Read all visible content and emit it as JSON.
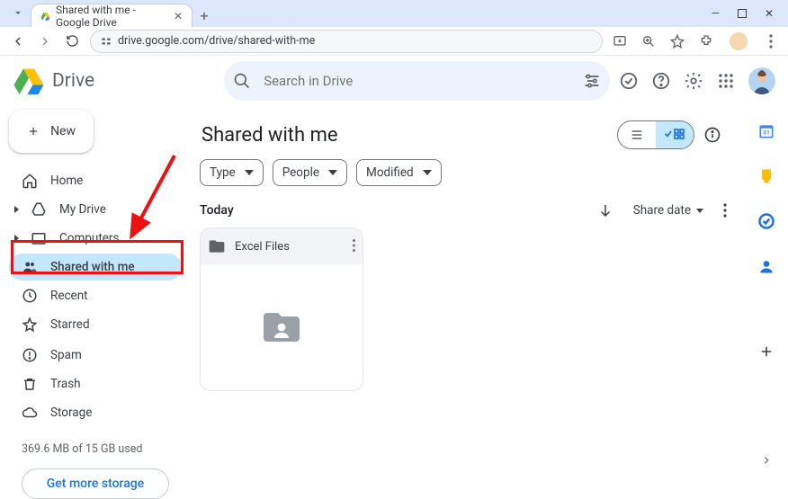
{
  "browser": {
    "tab_title": "Shared with me - Google Drive",
    "url": "drive.google.com/drive/shared-with-me"
  },
  "app": {
    "name": "Drive",
    "search_placeholder": "Search in Drive"
  },
  "sidebar": {
    "new_label": "New",
    "items": [
      {
        "label": "Home",
        "selected": false
      },
      {
        "label": "My Drive",
        "selected": false
      },
      {
        "label": "Computers",
        "selected": false
      },
      {
        "label": "Shared with me",
        "selected": true
      },
      {
        "label": "Recent",
        "selected": false
      },
      {
        "label": "Starred",
        "selected": false
      },
      {
        "label": "Spam",
        "selected": false
      },
      {
        "label": "Trash",
        "selected": false
      },
      {
        "label": "Storage",
        "selected": false
      }
    ],
    "quota_text": "369.6 MB of 15 GB used",
    "storage_btn": "Get more storage"
  },
  "content": {
    "title": "Shared with me",
    "chips": [
      "Type",
      "People",
      "Modified"
    ],
    "section_label": "Today",
    "sort_label": "Share date",
    "item_name": "Excel Files",
    "layout": "grid"
  }
}
